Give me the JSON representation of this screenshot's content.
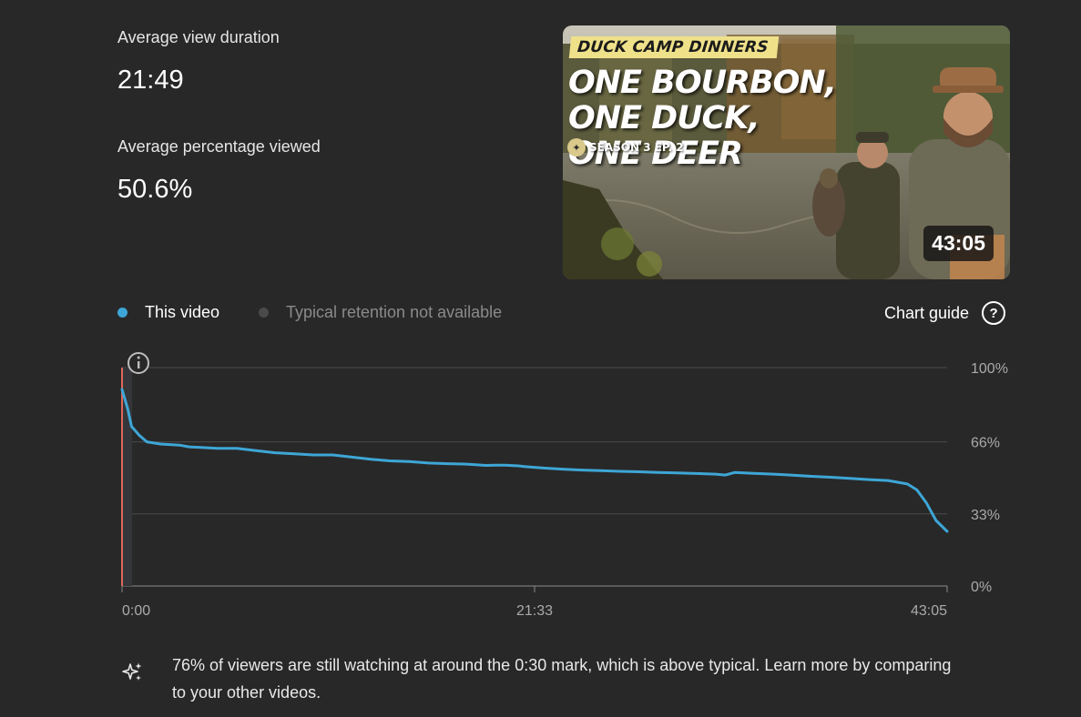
{
  "metrics": {
    "avg_view_duration_label": "Average view duration",
    "avg_view_duration_value": "21:49",
    "avg_percentage_label": "Average percentage viewed",
    "avg_percentage_value": "50.6%"
  },
  "thumbnail": {
    "series": "DUCK CAMP DINNERS",
    "title": "ONE BOURBON, ONE DUCK, ONE DEER",
    "season": "SEASON 3 EP. 2",
    "duration": "43:05"
  },
  "legend": {
    "this_video": "This video",
    "typical": "Typical retention not available",
    "chart_guide": "Chart guide",
    "colors": {
      "this_video": "#3ea6d6",
      "typical": "#4a4a4a"
    }
  },
  "chart_data": {
    "type": "line",
    "title": "",
    "xlabel": "",
    "ylabel": "",
    "x_ticks": [
      "0:00",
      "21:33",
      "43:05"
    ],
    "y_ticks": [
      "100%",
      "66%",
      "33%",
      "0%"
    ],
    "ylim": [
      0,
      100
    ],
    "x_unit": "minutes",
    "xlim": [
      0,
      43.08
    ],
    "series": [
      {
        "color": "#3ea6d6",
        "x": [
          0,
          0.3,
          0.5,
          0.9,
          1.3,
          2,
          3,
          3.5,
          4,
          5,
          6,
          7,
          8,
          9,
          10,
          11,
          12,
          13,
          14,
          15,
          16,
          17,
          18,
          19,
          19.5,
          20,
          20.7,
          21,
          22,
          23,
          24,
          25,
          26,
          27,
          28,
          29,
          30,
          31,
          31.5,
          32,
          33,
          34,
          34.5,
          35,
          36,
          37,
          38,
          39,
          40,
          40.5,
          41,
          41.5,
          42,
          42.5,
          43.08
        ],
        "y": [
          90,
          81,
          73,
          69,
          66,
          65,
          64.5,
          63.7,
          63.5,
          63,
          63,
          62,
          61,
          60.5,
          60,
          60,
          59,
          58,
          57.3,
          57,
          56.3,
          56,
          55.8,
          55.2,
          55.3,
          55.3,
          55,
          54.7,
          54,
          53.5,
          53.1,
          52.8,
          52.5,
          52.3,
          52,
          51.8,
          51.5,
          51.2,
          50.8,
          52,
          51.6,
          51.2,
          51,
          50.7,
          50.2,
          49.8,
          49.3,
          48.7,
          48.3,
          47.5,
          46.7,
          44,
          38,
          30,
          25
        ]
      }
    ]
  },
  "insight": {
    "text": "76% of viewers are still watching at around the 0:30 mark, which is above typical. Learn more by comparing to your other videos."
  }
}
